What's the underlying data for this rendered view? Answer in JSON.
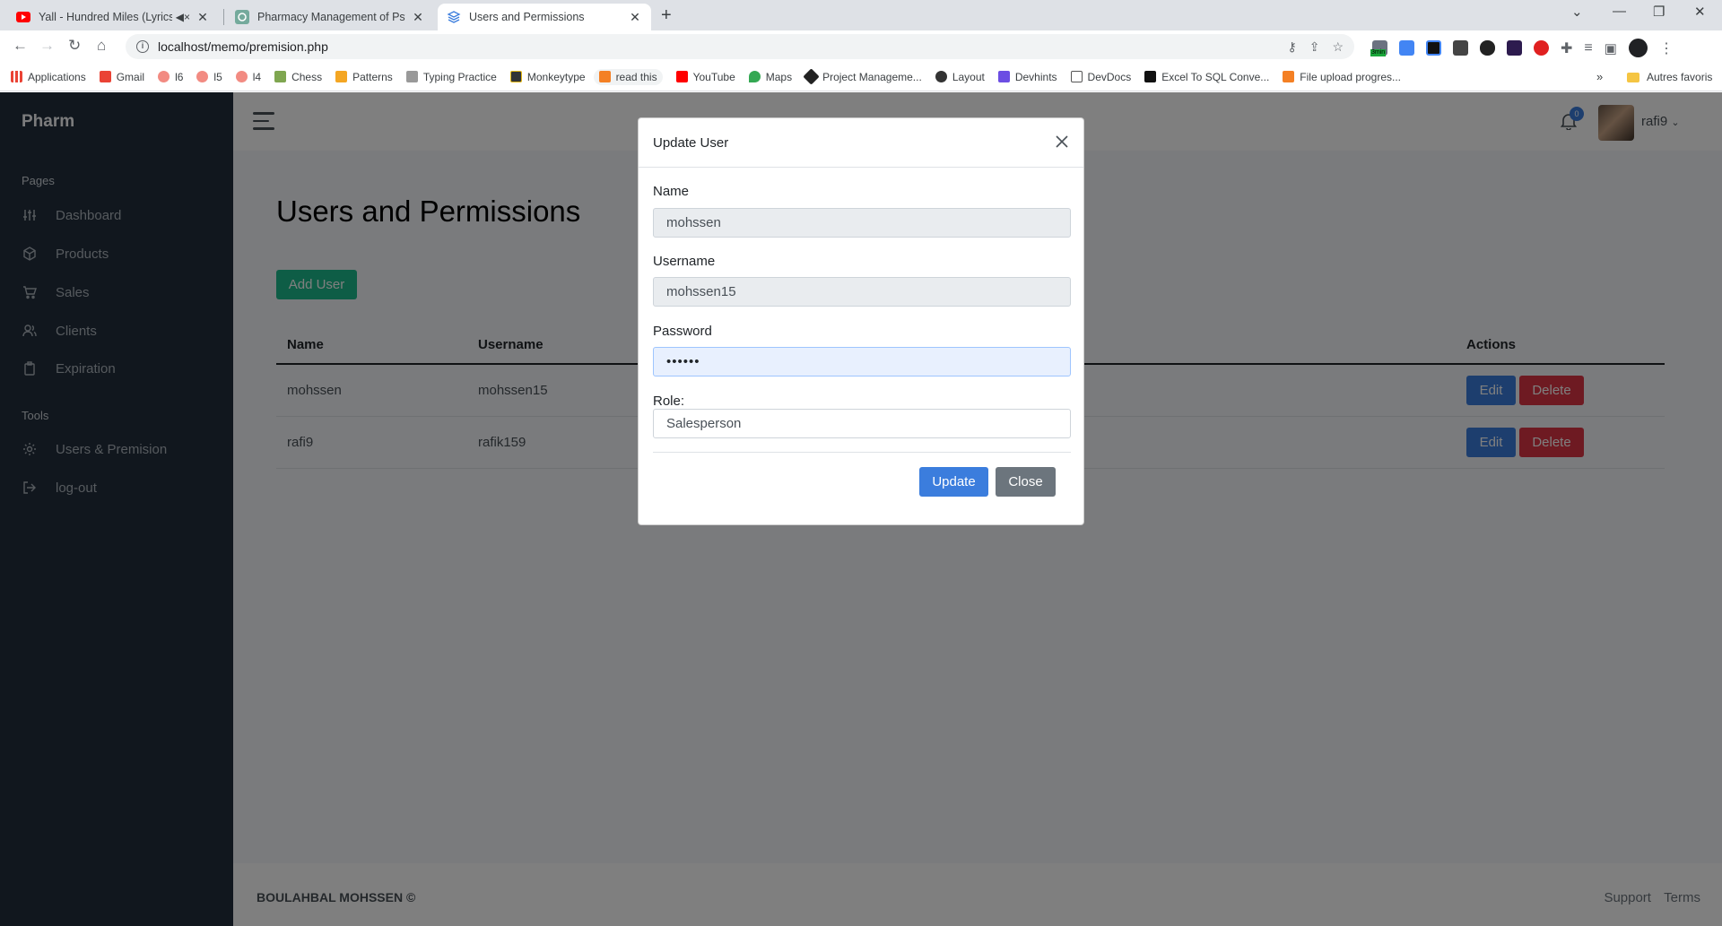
{
  "browser": {
    "tabs": [
      {
        "title": "Yall - Hundred Miles (Lyrics) (",
        "active": false
      },
      {
        "title": "Pharmacy Management of Psych",
        "active": false
      },
      {
        "title": "Users and Permissions",
        "active": true
      }
    ],
    "url": "localhost/memo/premision.php",
    "bookmarks": [
      "Applications",
      "Gmail",
      "l6",
      "l5",
      "l4",
      "Chess",
      "Patterns",
      "Typing Practice",
      "Monkeytype",
      "read this",
      "YouTube",
      "Maps",
      "Project Manageme...",
      "Layout",
      "Devhints",
      "DevDocs",
      "Excel To SQL Conve...",
      "File upload progres..."
    ],
    "other_bookmarks": "Autres favoris",
    "ext_badge": "3min"
  },
  "sidebar": {
    "brand": "Pharm",
    "pages_header": "Pages",
    "tools_header": "Tools",
    "items": [
      {
        "label": "Dashboard",
        "icon": "sliders-icon"
      },
      {
        "label": "Products",
        "icon": "box-icon"
      },
      {
        "label": "Sales",
        "icon": "cart-icon"
      },
      {
        "label": "Clients",
        "icon": "users-icon"
      },
      {
        "label": "Expiration",
        "icon": "clipboard-icon"
      }
    ],
    "tools": [
      {
        "label": "Users & Premision",
        "icon": "gear-icon"
      },
      {
        "label": "log-out",
        "icon": "logout-icon"
      }
    ]
  },
  "topnav": {
    "notification_count": "0",
    "user": "rafi9"
  },
  "page": {
    "title": "Users and Permissions",
    "add_user_label": "Add User",
    "table": {
      "headers": [
        "Name",
        "Username",
        "Actions"
      ],
      "rows": [
        {
          "name": "mohssen",
          "username": "mohssen15"
        },
        {
          "name": "rafi9",
          "username": "rafik159"
        }
      ],
      "edit_label": "Edit",
      "delete_label": "Delete"
    }
  },
  "footer": {
    "copyright": "BOULAHBAL MOHSSEN ©",
    "support": "Support",
    "terms": "Terms"
  },
  "modal": {
    "title": "Update User",
    "name_label": "Name",
    "name_value": "mohssen",
    "username_label": "Username",
    "username_value": "mohssen15",
    "password_label": "Password",
    "password_value": "••••••",
    "role_label": "Role:",
    "role_value": "Salesperson",
    "update_label": "Update",
    "close_label": "Close"
  },
  "colors": {
    "sidebar_bg": "#222e3c",
    "primary": "#3b7ddd",
    "success": "#1cbb8c",
    "danger": "#dc3545",
    "secondary": "#6c757d"
  }
}
